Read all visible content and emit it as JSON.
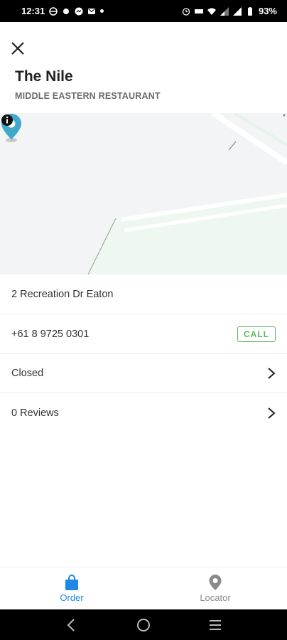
{
  "status_bar": {
    "time": "12:31",
    "battery": "93%"
  },
  "header": {
    "title": "The Nile",
    "subtitle": "MIDDLE EASTERN RESTAURANT"
  },
  "details": {
    "address": "2 Recreation Dr Eaton",
    "phone": "+61 8 9725 0301",
    "call_label": "CALL",
    "hours_status": "Closed",
    "reviews": "0 Reviews"
  },
  "bottom_nav": {
    "items": [
      {
        "label": "Order",
        "icon": "shopping-bag-icon",
        "active": true
      },
      {
        "label": "Locator",
        "icon": "map-pin-icon",
        "active": false
      }
    ]
  },
  "colors": {
    "accent": "#1e88e5",
    "pin": "#3fa9c9",
    "call": "#5cb85c"
  }
}
